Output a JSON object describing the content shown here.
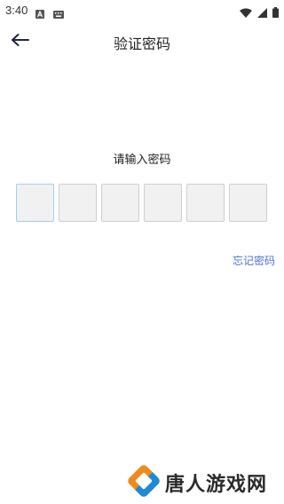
{
  "status_bar": {
    "time": "3:40"
  },
  "header": {
    "title": "验证密码"
  },
  "prompt": {
    "text": "请输入密码"
  },
  "pin": {
    "length": 6,
    "digits": [
      "",
      "",
      "",
      "",
      "",
      ""
    ]
  },
  "forgot_password": {
    "label": "忘记密码"
  },
  "watermark": {
    "text": "唐人游戏网"
  },
  "colors": {
    "link": "#4a73e0",
    "active_border": "#9fd0ec",
    "box_fill": "#f1f1f1",
    "logo_orange": "#f08a1c",
    "logo_blue": "#1d8ad8"
  },
  "icons": {
    "back": "arrow-left-icon",
    "notification_a": "a-badge-icon",
    "keyboard": "keyboard-icon",
    "wifi": "wifi-icon",
    "signal": "signal-icon",
    "battery": "battery-icon"
  }
}
